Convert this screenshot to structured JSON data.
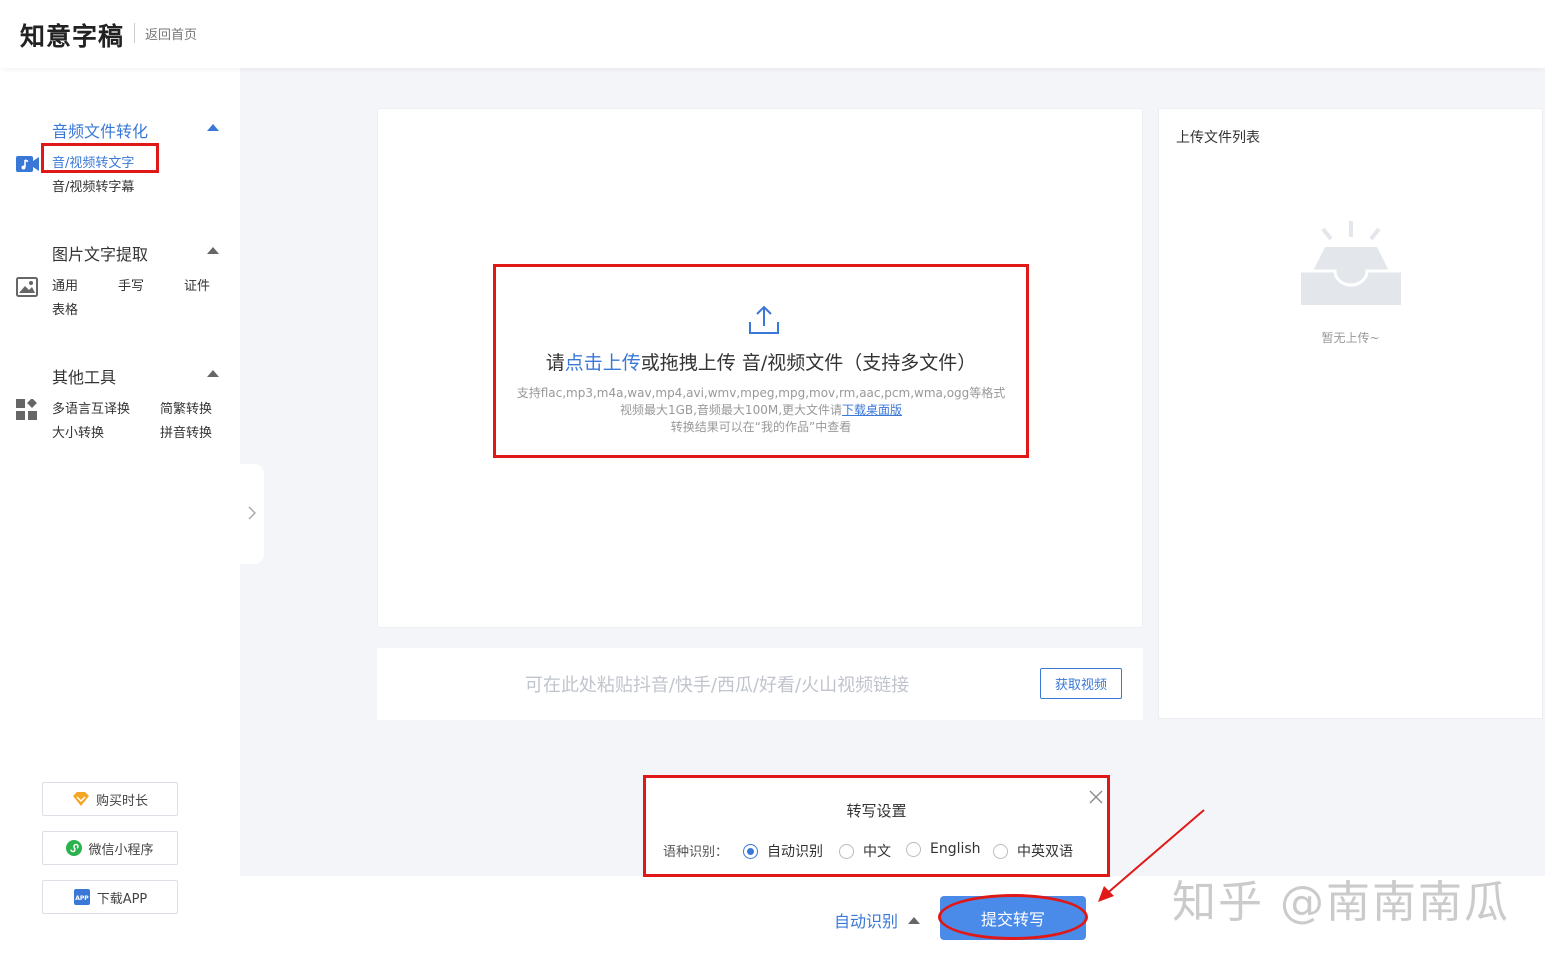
{
  "header": {
    "logo": "知意字稿",
    "back_home": "返回首页"
  },
  "sidebar": {
    "sections": [
      {
        "title": "音频文件转化",
        "icon": "music-video-icon",
        "items": [
          "音/视频转文字",
          "音/视频转字幕"
        ],
        "active_item": 0
      },
      {
        "title": "图片文字提取",
        "icon": "image-icon",
        "items": [
          "通用",
          "手写",
          "证件",
          "表格"
        ]
      },
      {
        "title": "其他工具",
        "icon": "apps-grid-icon",
        "items": [
          "多语言互译换",
          "简繁转换",
          "大小转换",
          "拼音转换"
        ]
      }
    ],
    "buttons": {
      "buy": "购买时长",
      "mini_program": "微信小程序",
      "download_app": "下载APP"
    },
    "app_icon_text": "APP"
  },
  "upload": {
    "prefix": "请",
    "link": "点击上传",
    "suffix": "或拖拽上传 音/视频文件（支持多文件）",
    "formats": "支持flac,mp3,m4a,wav,mp4,avi,wmv,mpeg,mpg,mov,rm,aac,pcm,wma,ogg等格式",
    "size_note": "视频最大1GB,音频最大100M,更大文件请",
    "desktop_link": "下载桌面版",
    "result_note": "转换结果可以在“我的作品”中查看"
  },
  "url_bar": {
    "placeholder": "可在此处粘贴抖音/快手/西瓜/好看/火山视频链接",
    "button": "获取视频"
  },
  "file_list": {
    "title": "上传文件列表",
    "empty": "暂无上传~"
  },
  "settings": {
    "title": "转写设置",
    "lang_label": "语种识别：",
    "options": [
      "自动识别",
      "中文",
      "English",
      "中英双语"
    ],
    "selected": "自动识别"
  },
  "bottom": {
    "auto_detect": "自动识别",
    "submit": "提交转写"
  },
  "watermark": "知乎 @南南南瓜",
  "colors": {
    "accent": "#3a78d8",
    "button": "#4a8be9",
    "annotation_red": "#e01818"
  }
}
